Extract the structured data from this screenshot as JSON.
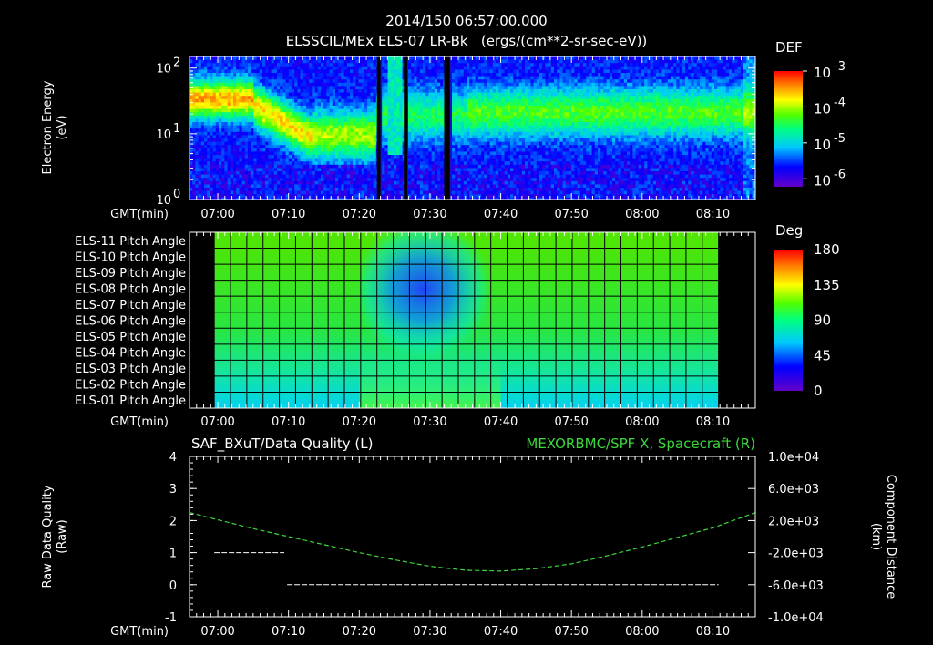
{
  "header": {
    "timestamp": "2014/150 06:57:00.000",
    "subtitle": "ELSSCIL/MEx ELS-07 LR-Bk   (ergs/(cm**2-sr-sec-eV))"
  },
  "colors": {
    "background": "#000000",
    "axis": "#ffffff",
    "spacecraft_line": "#3dd63d",
    "quality_line": "#ffffff"
  },
  "time_axis": {
    "label": "GMT(min)",
    "ticks": [
      "07:00",
      "07:10",
      "07:20",
      "07:30",
      "07:40",
      "07:50",
      "08:00",
      "08:10"
    ],
    "start_minutes": 416,
    "end_minutes": 496
  },
  "chart_data": [
    {
      "type": "heatmap",
      "panel": "spectrogram",
      "ylabel": "Electron Energy\n(eV)",
      "yscale": "log",
      "ylim": [
        1,
        150
      ],
      "yticks": [
        {
          "base": "10",
          "exp": "0",
          "value": 1
        },
        {
          "base": "10",
          "exp": "1",
          "value": 10
        },
        {
          "base": "10",
          "exp": "2",
          "value": 100
        }
      ],
      "colorbar": {
        "label": "DEF",
        "scale": "log",
        "range": [
          6e-07,
          0.001
        ],
        "ticks": [
          {
            "base": "10",
            "exp": "-3",
            "value": 0.001
          },
          {
            "base": "10",
            "exp": "-4",
            "value": 0.0001
          },
          {
            "base": "10",
            "exp": "-5",
            "value": 1e-05
          },
          {
            "base": "10",
            "exp": "-6",
            "value": 1e-06
          }
        ]
      },
      "data_gaps": [
        [
          442.5,
          443.0
        ],
        [
          446.3,
          446.8
        ],
        [
          452.0,
          452.8
        ]
      ]
    },
    {
      "type": "heatmap",
      "panel": "pitch-angle",
      "rows": [
        "ELS-11 Pitch Angle",
        "ELS-10 Pitch Angle",
        "ELS-09 Pitch Angle",
        "ELS-08 Pitch Angle",
        "ELS-07 Pitch Angle",
        "ELS-06 Pitch Angle",
        "ELS-05 Pitch Angle",
        "ELS-04 Pitch Angle",
        "ELS-03 Pitch Angle",
        "ELS-02 Pitch Angle",
        "ELS-01 Pitch Angle"
      ],
      "x_range": [
        419.5,
        490.8
      ],
      "colorbar": {
        "label": "Deg",
        "range": [
          0,
          180
        ],
        "ticks": [
          "180",
          "135",
          "90",
          "45",
          "0"
        ]
      }
    },
    {
      "type": "line",
      "panel": "data-quality",
      "title_left": "SAF_BXuT/Data Quality (L)",
      "title_right": "MEXORBMC/SPF X, Spacecraft (R)",
      "ylabel_left": "Raw Data Quality\n(Raw)",
      "ylabel_right": "Component Distance\n(km)",
      "ylim_left": [
        -1,
        4
      ],
      "yticks_left": [
        "4",
        "3",
        "2",
        "1",
        "0",
        "-1"
      ],
      "ylim_right": [
        -10000,
        10000
      ],
      "yticks_right": [
        "1.0e+04",
        "6.0e+03",
        "2.0e+03",
        "-2.0e+03",
        "-6.0e+03",
        "-1.0e+04"
      ],
      "series": [
        {
          "name": "SAF_BXuT/Data Quality",
          "axis": "left",
          "segments": [
            {
              "x": [
                419.5,
                429.4
              ],
              "y": [
                1,
                1
              ]
            },
            {
              "x": [
                429.8,
                490.8
              ],
              "y": [
                0,
                0
              ]
            }
          ]
        },
        {
          "name": "MEXORBMC/SPF X, Spacecraft",
          "axis": "right",
          "x": [
            416,
            420,
            425,
            430,
            435,
            440,
            445,
            450,
            455,
            460,
            465,
            470,
            475,
            480,
            485,
            490,
            496
          ],
          "y": [
            3000,
            2100,
            1000,
            0,
            -1000,
            -2000,
            -2900,
            -3700,
            -4200,
            -4300,
            -4000,
            -3400,
            -2400,
            -1300,
            -100,
            1100,
            3000
          ]
        }
      ]
    }
  ]
}
